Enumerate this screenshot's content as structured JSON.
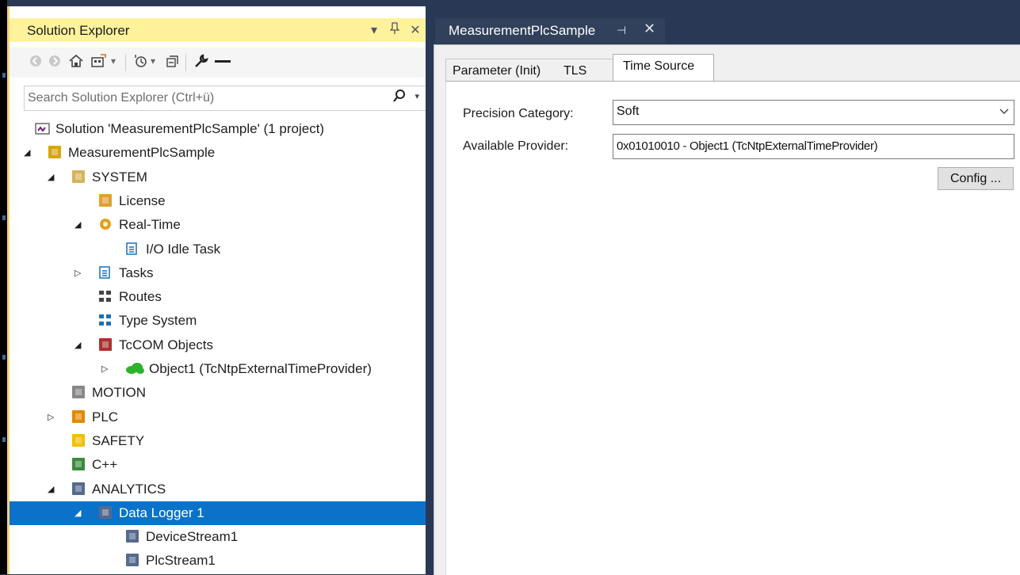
{
  "solution_explorer": {
    "title": "Solution Explorer",
    "title_buttons": {
      "dropdown": "▾",
      "pin": "📌",
      "close": "✕"
    },
    "search": {
      "placeholder": "Search Solution Explorer (Ctrl+ü)"
    },
    "tree": [
      {
        "label": "Solution 'MeasurementPlcSample' (1 project)",
        "icon": "solution-icon",
        "arrow": ""
      },
      {
        "label": "MeasurementPlcSample",
        "icon": "project-icon",
        "arrow": "expanded"
      },
      {
        "label": "SYSTEM",
        "icon": "system-icon",
        "arrow": "expanded"
      },
      {
        "label": "License",
        "icon": "license-icon",
        "arrow": ""
      },
      {
        "label": "Real-Time",
        "icon": "realtime-icon",
        "arrow": "expanded"
      },
      {
        "label": "I/O Idle Task",
        "icon": "task-icon",
        "arrow": ""
      },
      {
        "label": "Tasks",
        "icon": "tasks-icon",
        "arrow": "collapsed"
      },
      {
        "label": "Routes",
        "icon": "routes-icon",
        "arrow": ""
      },
      {
        "label": "Type System",
        "icon": "type-system-icon",
        "arrow": ""
      },
      {
        "label": "TcCOM Objects",
        "icon": "tccom-icon",
        "arrow": "expanded"
      },
      {
        "label": "Object1 (TcNtpExternalTimeProvider)",
        "icon": "cloud-object-icon",
        "arrow": "collapsed"
      },
      {
        "label": "MOTION",
        "icon": "motion-icon",
        "arrow": ""
      },
      {
        "label": "PLC",
        "icon": "plc-icon",
        "arrow": "collapsed"
      },
      {
        "label": "SAFETY",
        "icon": "safety-icon",
        "arrow": ""
      },
      {
        "label": "C++",
        "icon": "cpp-icon",
        "arrow": ""
      },
      {
        "label": "ANALYTICS",
        "icon": "analytics-icon",
        "arrow": "expanded"
      },
      {
        "label": "Data Logger 1",
        "icon": "data-logger-icon",
        "arrow": "expanded",
        "selected": true
      },
      {
        "label": "DeviceStream1",
        "icon": "stream-icon",
        "arrow": ""
      },
      {
        "label": "PlcStream1",
        "icon": "stream-icon",
        "arrow": ""
      }
    ]
  },
  "editor": {
    "doc_tab": {
      "label": "MeasurementPlcSample",
      "pin": "⊣",
      "close": "✕"
    },
    "tabs": [
      {
        "label": "Parameter (Init)"
      },
      {
        "label": "TLS"
      },
      {
        "label": "Time Source",
        "active": true
      }
    ],
    "precision_category": {
      "label": "Precision Category:",
      "value": "Soft"
    },
    "available_provider": {
      "label": "Available Provider:",
      "value": "0x01010010 - Object1 (TcNtpExternalTimeProvider)"
    },
    "config_button": "Config ..."
  },
  "colors": {
    "title_bar": "#fff29d",
    "selection": "#0a72c8",
    "frame": "#293955"
  }
}
